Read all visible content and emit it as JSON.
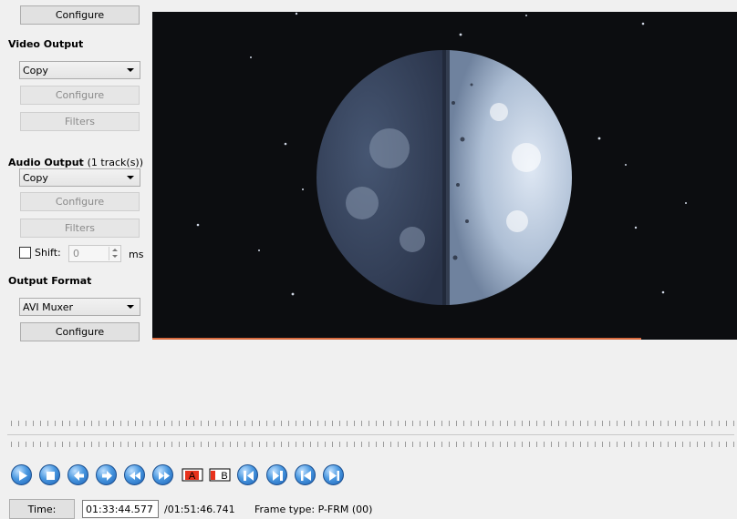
{
  "left_panel": {
    "top_configure": "Configure",
    "video_output": {
      "title": "Video Output",
      "codec": "Copy",
      "configure": "Configure",
      "filters": "Filters"
    },
    "audio_output": {
      "title": "Audio Output",
      "tracks": "(1 track(s))",
      "codec": "Copy",
      "configure": "Configure",
      "filters": "Filters",
      "shift_label": "Shift:",
      "shift_value": "0",
      "shift_unit": "ms",
      "shift_checked": false
    },
    "output_format": {
      "title": "Output Format",
      "muxer": "AVI Muxer",
      "configure": "Configure"
    }
  },
  "toolbar": {
    "buttons": [
      "play-icon",
      "stop-icon",
      "previous-frame-icon",
      "next-frame-icon",
      "rewind-icon",
      "fast-forward-icon",
      "set-marker-a-icon",
      "set-marker-b-icon",
      "previous-keyframe-icon",
      "next-keyframe-icon",
      "go-to-start-icon",
      "go-to-end-icon"
    ],
    "marker_a": "A",
    "marker_b": "B"
  },
  "status": {
    "time_button": "Time:",
    "current_time": "01:33:44.577",
    "total_time": "/01:51:46.741",
    "frame_type_label": "Frame type:",
    "frame_type_value": "P-FRM (00)"
  },
  "colors": {
    "accent": "#2a7bd3",
    "video_progress": "#d86a3e",
    "marker_red": "#e8321c"
  }
}
